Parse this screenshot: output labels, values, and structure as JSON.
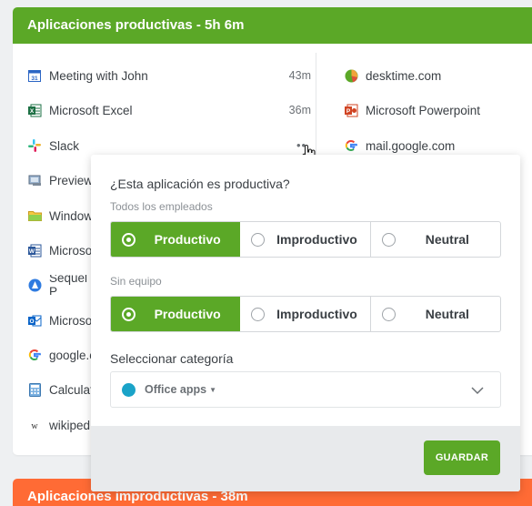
{
  "productive_card": {
    "title": "Aplicaciones productivas - 5h 6m",
    "left_items": [
      {
        "icon": "calendar-icon",
        "name": "Meeting with John",
        "duration": "43m"
      },
      {
        "icon": "excel-icon",
        "name": "Microsoft Excel",
        "duration": "36m"
      },
      {
        "icon": "slack-icon",
        "name": "Slack",
        "duration": ""
      },
      {
        "icon": "preview-icon",
        "name": "Preview",
        "duration": ""
      },
      {
        "icon": "folder-icon",
        "name": "Window",
        "duration": ""
      },
      {
        "icon": "word-icon",
        "name": "Microso",
        "duration": ""
      },
      {
        "icon": "sequel-icon",
        "name": "Sequel P",
        "duration": ""
      },
      {
        "icon": "outlook-icon",
        "name": "Microso",
        "duration": ""
      },
      {
        "icon": "google-icon",
        "name": "google.c",
        "duration": ""
      },
      {
        "icon": "calculator-icon",
        "name": "Calculat",
        "duration": ""
      },
      {
        "icon": "wikipedia-icon",
        "name": "wikiped",
        "duration": ""
      }
    ],
    "right_items": [
      {
        "icon": "desktime-icon",
        "name": "desktime.com"
      },
      {
        "icon": "powerpoint-icon",
        "name": "Microsoft Powerpoint"
      },
      {
        "icon": "google-icon",
        "name": "mail.google.com"
      }
    ]
  },
  "unproductive_card": {
    "title": "Aplicaciones improductivas - 38m"
  },
  "popover": {
    "question": "¿Esta aplicación es productiva?",
    "group1_label": "Todos los empleados",
    "group2_label": "Sin equipo",
    "options": [
      "Productivo",
      "Improductivo",
      "Neutral"
    ],
    "group1_selected": "Productivo",
    "group2_selected": "Productivo",
    "category_label": "Seleccionar categoría",
    "category_value": "Office apps",
    "category_color": "#1aa3c8",
    "save_label": "GUARDAR"
  },
  "colors": {
    "productive": "#5ba827",
    "unproductive": "#ff6b35"
  }
}
